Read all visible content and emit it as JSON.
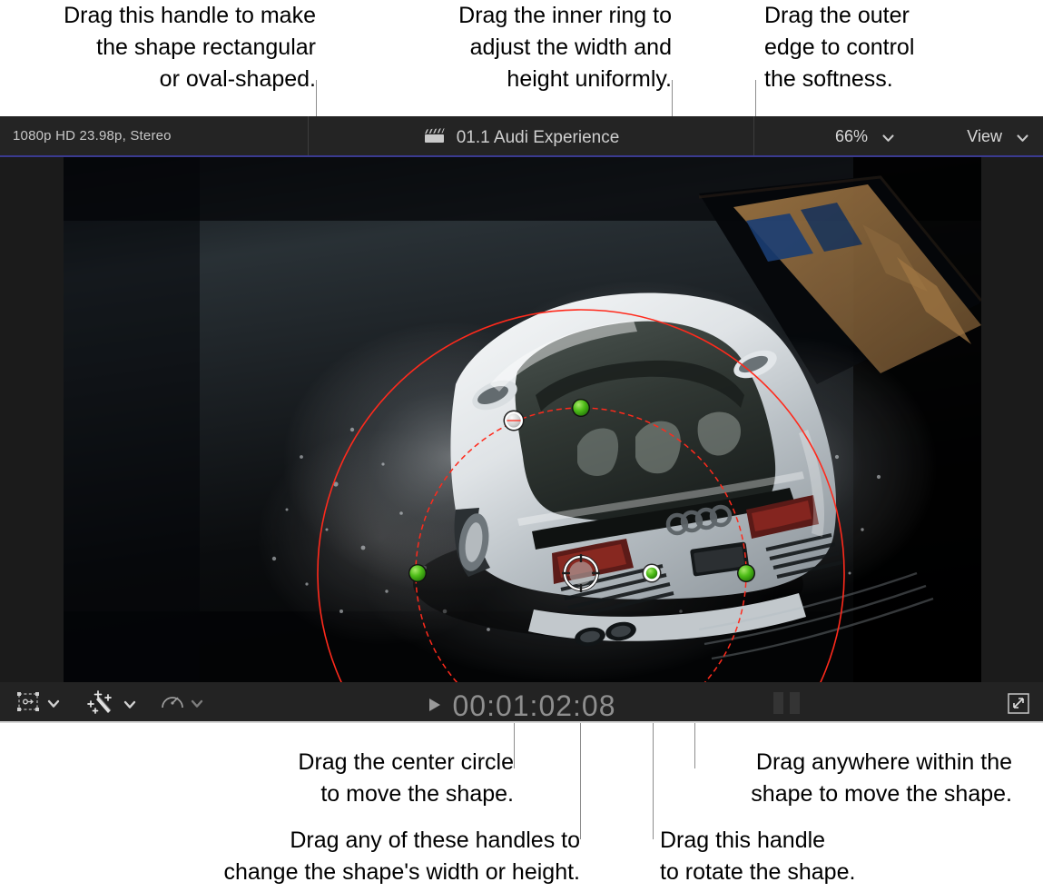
{
  "callouts": {
    "top": [
      {
        "id": "shape-roundness",
        "text": "Drag this handle to make\nthe shape rectangular\nor oval-shaped."
      },
      {
        "id": "inner-ring",
        "text": "Drag the inner ring to\nadjust the width and\nheight uniformly."
      },
      {
        "id": "outer-edge",
        "text": "Drag the outer\nedge to control\nthe softness."
      }
    ],
    "bottom": [
      {
        "id": "center-circle",
        "text": "Drag the center circle\nto move the shape."
      },
      {
        "id": "inside-shape",
        "text": "Drag anywhere within the\nshape to move the shape."
      },
      {
        "id": "width-height-handles",
        "text": "Drag any of these handles to\nchange the shape's width or height."
      },
      {
        "id": "rotate-handle",
        "text": "Drag this handle\nto rotate the shape."
      }
    ]
  },
  "viewer": {
    "header": {
      "clip_format": "1080p HD 23.98p, Stereo",
      "clip_icon": "clapperboard-icon",
      "clip_title": "01.1 Audi Experience",
      "zoom_level": "66%",
      "zoom_chevron": "chevron-down-icon",
      "view_label": "View",
      "view_chevron": "chevron-down-icon"
    },
    "toolbar": {
      "transform_icon": "transform-icon",
      "transform_chevron": "chevron-down-icon",
      "enhance_icon": "magic-wand-icon",
      "enhance_chevron": "chevron-down-icon",
      "retime_icon": "speedometer-icon",
      "retime_chevron": "chevron-down-icon",
      "play_icon": "play-triangle-icon",
      "timecode": "00:01:02:08",
      "fullscreen_icon": "expand-arrows-icon"
    },
    "overlay": {
      "shape_name": "shape-mask",
      "outer_circle_color": "#ff2a1c",
      "inner_circle_color": "#ff2a1c",
      "handle_color": "#46b414",
      "center_handle_color": "#b8b8b8",
      "roundness_handle_color": "#d4d4d4"
    }
  },
  "colors": {
    "page_background": "#ffffff",
    "header_background": "#242424",
    "toolbar_background": "#232323",
    "video_background": "#000000",
    "accent_line": "#3a3a8f",
    "leader_line": "#8d8d8d",
    "text_primary": "#000000",
    "text_header": "#cfcfcf"
  }
}
